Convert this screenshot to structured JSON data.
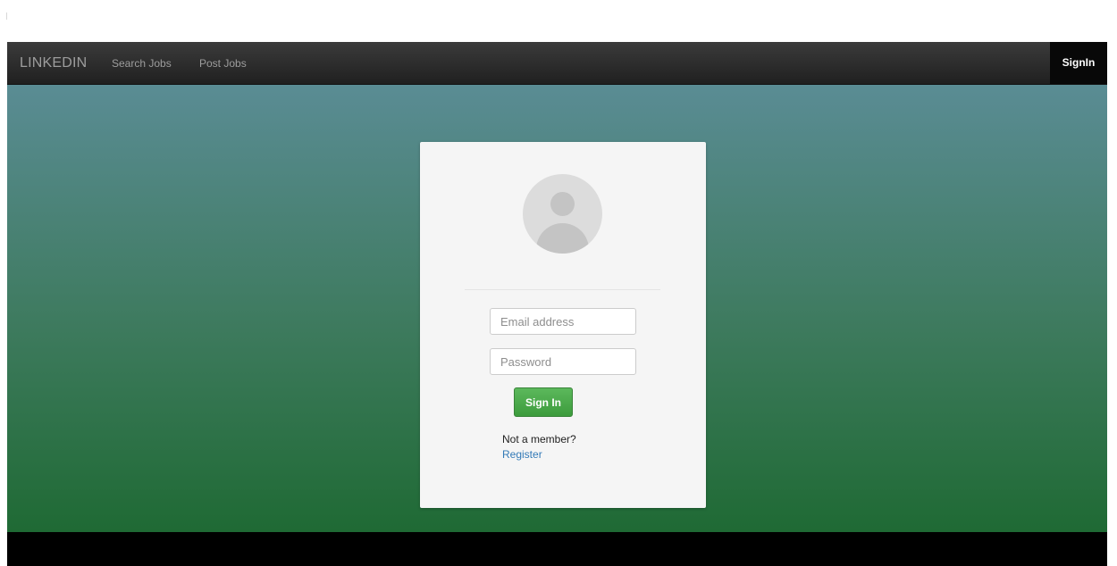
{
  "navbar": {
    "brand": "LINKEDIN",
    "links": [
      {
        "label": "Search Jobs"
      },
      {
        "label": "Post Jobs"
      }
    ],
    "signin_label": "SignIn"
  },
  "login": {
    "email_placeholder": "Email address",
    "email_value": "",
    "password_placeholder": "Password",
    "password_value": "",
    "submit_label": "Sign In",
    "member_prompt": "Not a member?",
    "register_label": "Register"
  },
  "colors": {
    "navbar": "#2a2a2a",
    "hero_top": "#5a8c94",
    "hero_bottom": "#1f6a34",
    "button_green": "#5cb85c",
    "link_blue": "#337ab7"
  },
  "icons": {
    "avatar": "user-placeholder-icon"
  }
}
